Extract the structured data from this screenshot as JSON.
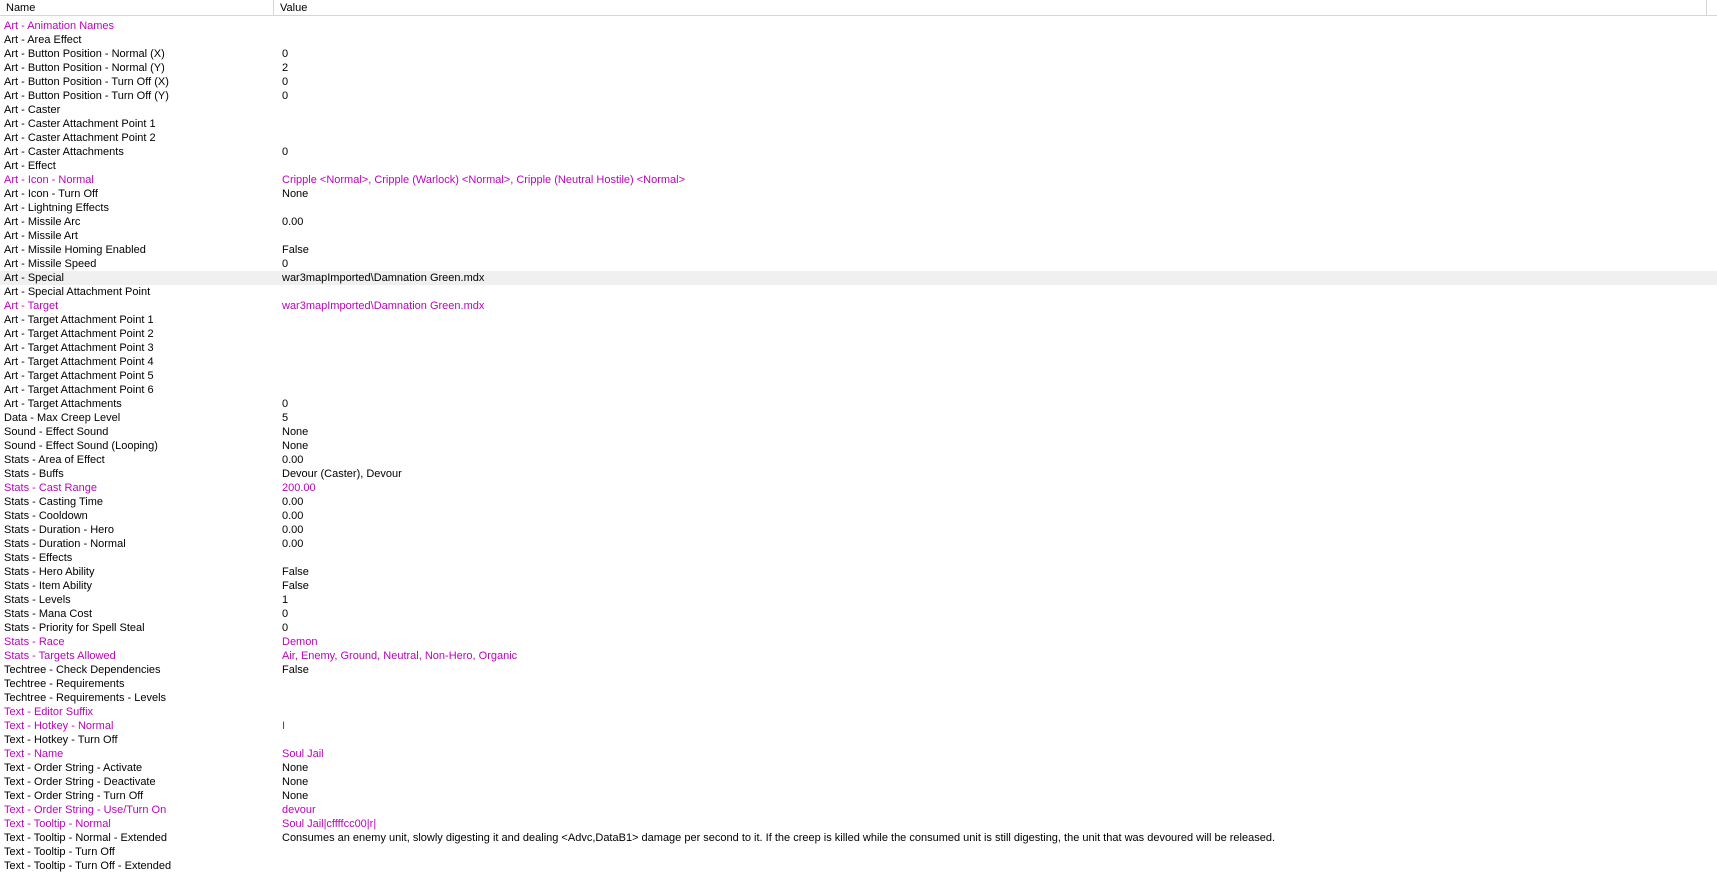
{
  "columns": {
    "name": "Name",
    "value": "Value"
  },
  "colors": {
    "modified": "#c000c0",
    "normal": "#000000",
    "selected_bg": "#f0f0f0"
  },
  "rows": [
    {
      "name": "Art - Animation Names",
      "value": "",
      "modified": true
    },
    {
      "name": "Art - Area Effect",
      "value": ""
    },
    {
      "name": "Art - Button Position - Normal (X)",
      "value": "0"
    },
    {
      "name": "Art - Button Position - Normal (Y)",
      "value": "2"
    },
    {
      "name": "Art - Button Position - Turn Off (X)",
      "value": "0"
    },
    {
      "name": "Art - Button Position - Turn Off (Y)",
      "value": "0"
    },
    {
      "name": "Art - Caster",
      "value": ""
    },
    {
      "name": "Art - Caster Attachment Point 1",
      "value": ""
    },
    {
      "name": "Art - Caster Attachment Point 2",
      "value": ""
    },
    {
      "name": "Art - Caster Attachments",
      "value": "0"
    },
    {
      "name": "Art - Effect",
      "value": ""
    },
    {
      "name": "Art - Icon - Normal",
      "value": "Cripple <Normal>, Cripple (Warlock) <Normal>, Cripple (Neutral Hostile) <Normal>",
      "modified": true
    },
    {
      "name": "Art - Icon - Turn Off",
      "value": "None"
    },
    {
      "name": "Art - Lightning Effects",
      "value": ""
    },
    {
      "name": "Art - Missile Arc",
      "value": "0.00"
    },
    {
      "name": "Art - Missile Art",
      "value": ""
    },
    {
      "name": "Art - Missile Homing Enabled",
      "value": "False"
    },
    {
      "name": "Art - Missile Speed",
      "value": "0"
    },
    {
      "name": "Art - Special",
      "value": "war3mapImported\\Damnation Green.mdx",
      "selected": true
    },
    {
      "name": "Art - Special Attachment Point",
      "value": ""
    },
    {
      "name": "Art - Target",
      "value": "war3mapImported\\Damnation Green.mdx",
      "modified": true
    },
    {
      "name": "Art - Target Attachment Point 1",
      "value": ""
    },
    {
      "name": "Art - Target Attachment Point 2",
      "value": ""
    },
    {
      "name": "Art - Target Attachment Point 3",
      "value": ""
    },
    {
      "name": "Art - Target Attachment Point 4",
      "value": ""
    },
    {
      "name": "Art - Target Attachment Point 5",
      "value": ""
    },
    {
      "name": "Art - Target Attachment Point 6",
      "value": ""
    },
    {
      "name": "Art - Target Attachments",
      "value": "0"
    },
    {
      "name": "Data - Max Creep Level",
      "value": "5"
    },
    {
      "name": "Sound - Effect Sound",
      "value": "None"
    },
    {
      "name": "Sound - Effect Sound (Looping)",
      "value": "None"
    },
    {
      "name": "Stats - Area of Effect",
      "value": "0.00"
    },
    {
      "name": "Stats - Buffs",
      "value": "Devour (Caster), Devour"
    },
    {
      "name": "Stats - Cast Range",
      "value": "200.00",
      "modified": true
    },
    {
      "name": "Stats - Casting Time",
      "value": "0.00"
    },
    {
      "name": "Stats - Cooldown",
      "value": "0.00"
    },
    {
      "name": "Stats - Duration - Hero",
      "value": "0.00"
    },
    {
      "name": "Stats - Duration - Normal",
      "value": "0.00"
    },
    {
      "name": "Stats - Effects",
      "value": ""
    },
    {
      "name": "Stats - Hero Ability",
      "value": "False"
    },
    {
      "name": "Stats - Item Ability",
      "value": "False"
    },
    {
      "name": "Stats - Levels",
      "value": "1"
    },
    {
      "name": "Stats - Mana Cost",
      "value": "0"
    },
    {
      "name": "Stats - Priority for Spell Steal",
      "value": "0"
    },
    {
      "name": "Stats - Race",
      "value": "Demon",
      "modified": true
    },
    {
      "name": "Stats - Targets Allowed",
      "value": "Air, Enemy, Ground, Neutral, Non-Hero, Organic",
      "modified": true
    },
    {
      "name": "Techtree - Check Dependencies",
      "value": "False"
    },
    {
      "name": "Techtree - Requirements",
      "value": ""
    },
    {
      "name": "Techtree - Requirements - Levels",
      "value": ""
    },
    {
      "name": "Text - Editor Suffix",
      "value": "",
      "modified": true
    },
    {
      "name": "Text - Hotkey - Normal",
      "value": "I",
      "modified": true
    },
    {
      "name": "Text - Hotkey - Turn Off",
      "value": ""
    },
    {
      "name": "Text - Name",
      "value": "Soul Jail",
      "modified": true
    },
    {
      "name": "Text - Order String - Activate",
      "value": "None"
    },
    {
      "name": "Text - Order String - Deactivate",
      "value": "None"
    },
    {
      "name": "Text - Order String - Turn Off",
      "value": "None"
    },
    {
      "name": "Text - Order String - Use/Turn On",
      "value": "devour",
      "modified": true
    },
    {
      "name": "Text - Tooltip - Normal",
      "value": "Soul Jail|cffffcc00|r|",
      "modified": true
    },
    {
      "name": "Text - Tooltip - Normal - Extended",
      "value": "Consumes an enemy unit, slowly digesting it and dealing <Advc,DataB1> damage per second to it.  If the creep is killed while the consumed unit is still digesting, the unit that was devoured will be released."
    },
    {
      "name": "Text - Tooltip - Turn Off",
      "value": ""
    },
    {
      "name": "Text - Tooltip - Turn Off - Extended",
      "value": ""
    }
  ]
}
